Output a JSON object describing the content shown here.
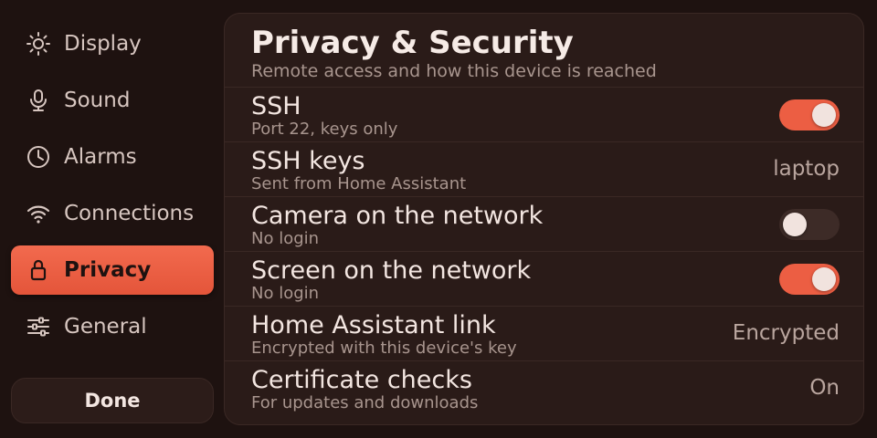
{
  "sidebar": {
    "items": [
      {
        "label": "Display",
        "icon": "sun-icon",
        "active": false
      },
      {
        "label": "Sound",
        "icon": "microphone-icon",
        "active": false
      },
      {
        "label": "Alarms",
        "icon": "clock-icon",
        "active": false
      },
      {
        "label": "Connections",
        "icon": "wifi-icon",
        "active": false
      },
      {
        "label": "Privacy",
        "icon": "lock-icon",
        "active": true
      },
      {
        "label": "General",
        "icon": "sliders-icon",
        "active": false
      }
    ],
    "done_label": "Done"
  },
  "panel": {
    "title": "Privacy & Security",
    "subtitle": "Remote access and how this device is reached",
    "rows": [
      {
        "title": "SSH",
        "subtitle": "Port 22, keys only",
        "control": "toggle",
        "on": true
      },
      {
        "title": "SSH keys",
        "subtitle": "Sent from Home Assistant",
        "control": "value",
        "value": "laptop"
      },
      {
        "title": "Camera on the network",
        "subtitle": "No login",
        "control": "toggle",
        "on": false
      },
      {
        "title": "Screen on the network",
        "subtitle": "No login",
        "control": "toggle",
        "on": true
      },
      {
        "title": "Home Assistant link",
        "subtitle": "Encrypted with this device's key",
        "control": "value",
        "value": "Encrypted"
      },
      {
        "title": "Certificate checks",
        "subtitle": "For updates and downloads",
        "control": "value",
        "value": "On"
      }
    ]
  },
  "colors": {
    "accent": "#ec5e43",
    "background": "#1e1210",
    "panel": "#2a1b18"
  }
}
